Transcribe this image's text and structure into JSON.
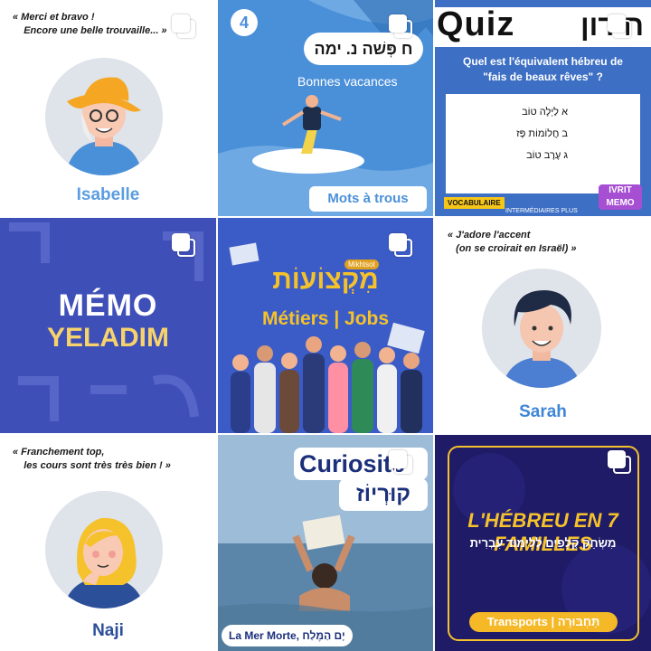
{
  "tiles": [
    {
      "quote": "« Merci et bravo !\n    Encore une belle trouvaille... »",
      "name": "Isabelle",
      "colors": {
        "name": "#5b9de0",
        "hat": "#f5a623",
        "shirt": "#4a90d9"
      }
    },
    {
      "number": "4",
      "hebrew": "ח פְּשׁה נ. ימה",
      "subtitle": "Bonnes vacances",
      "footer": "Mots à trous",
      "colors": {
        "bg": "#4a90d9"
      }
    },
    {
      "title": "Quiz",
      "hebrew_title": "חידון",
      "question": "Quel est l'équivalent hébreu de\n\"fais de beaux rêves\" ?",
      "answers": [
        {
          "letter": "א",
          "text": "לַיְלָה טוֹב"
        },
        {
          "letter": "ב",
          "text": "חֲלוֹמוֹת פָּז"
        },
        {
          "letter": "ג",
          "text": "עֶרֶב טוֹב"
        }
      ],
      "tag": "VOCABULAIRE",
      "level": "INTERMÉDIAIRES PLUS",
      "logo": "IVRIT\nMEMO"
    },
    {
      "title": "MÉMO",
      "subtitle": "YELADIM"
    },
    {
      "hebrew_title": "מִקְצוֹעוֹת",
      "tag": "Mikhtsot",
      "subtitle": "Métiers | Jobs"
    },
    {
      "quote": "« J'adore l'accent\n   (on se croirait en Israël) »",
      "name": "Sarah"
    },
    {
      "quote": "« Franchement top,\n    les cours sont très très bien ! »",
      "name": "Naji"
    },
    {
      "title": "Curiosité",
      "hebrew_title": "קוּרְיוֹז",
      "footer": "La Mer Morte, יָם הַמֶּלַח"
    },
    {
      "title": "L'HÉBREU EN 7 FAMILLES",
      "hebrew_subtitle": "מִשְׂחַק קְלָפִים לְלִימּוּד עִבְרִית",
      "footer": "Transports | תַּחְבּוּרָה"
    }
  ]
}
